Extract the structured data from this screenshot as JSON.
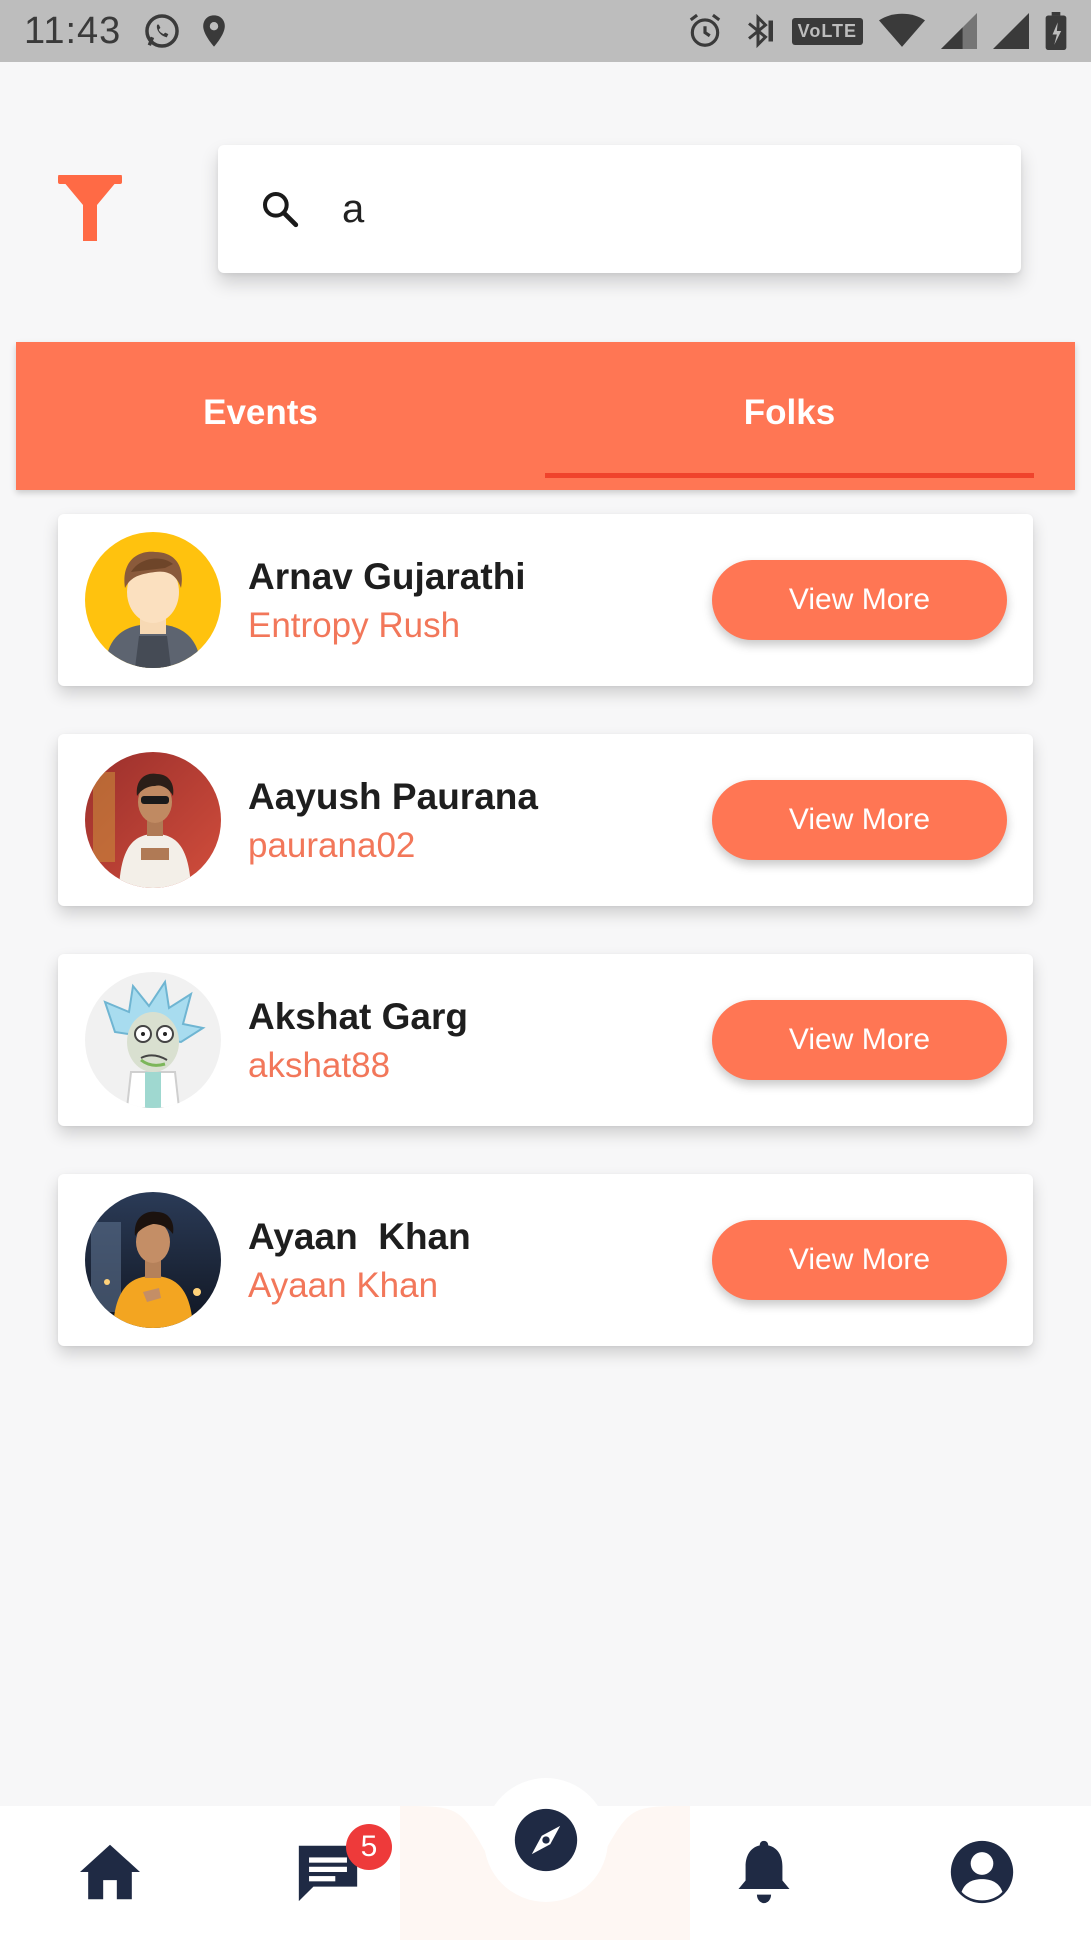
{
  "status_bar": {
    "time": "11:43",
    "volte_label": "VoLTE",
    "icons": [
      "whatsapp-icon",
      "location-icon",
      "alarm-icon",
      "bluetooth-icon",
      "volte-icon",
      "wifi-icon",
      "signal-icon",
      "signal-icon",
      "battery-icon"
    ]
  },
  "filter": {
    "icon": "filter-icon"
  },
  "search": {
    "value": "a",
    "icon": "search-icon"
  },
  "tabs": [
    {
      "label": "Events",
      "selected": false
    },
    {
      "label": "Folks",
      "selected": true
    }
  ],
  "folks": [
    {
      "name": "Arnav Gujarathi",
      "subtitle": "Entropy Rush",
      "button": "View More"
    },
    {
      "name": "Aayush Paurana",
      "subtitle": "paurana02",
      "button": "View More"
    },
    {
      "name": "Akshat Garg",
      "subtitle": "akshat88",
      "button": "View More"
    },
    {
      "name": "Ayaan  Khan",
      "subtitle": "Ayaan Khan",
      "button": "View More"
    }
  ],
  "bottom_nav": {
    "items": [
      "home-icon",
      "chat-icon",
      "explore-icon",
      "notifications-icon",
      "profile-icon"
    ],
    "chat_badge": "5"
  },
  "colors": {
    "accent": "#ff7654",
    "accent_text": "#f2775a",
    "tab_indicator": "#f0432c",
    "nav_icon": "#1f2a44",
    "badge": "#ee3a3a"
  }
}
